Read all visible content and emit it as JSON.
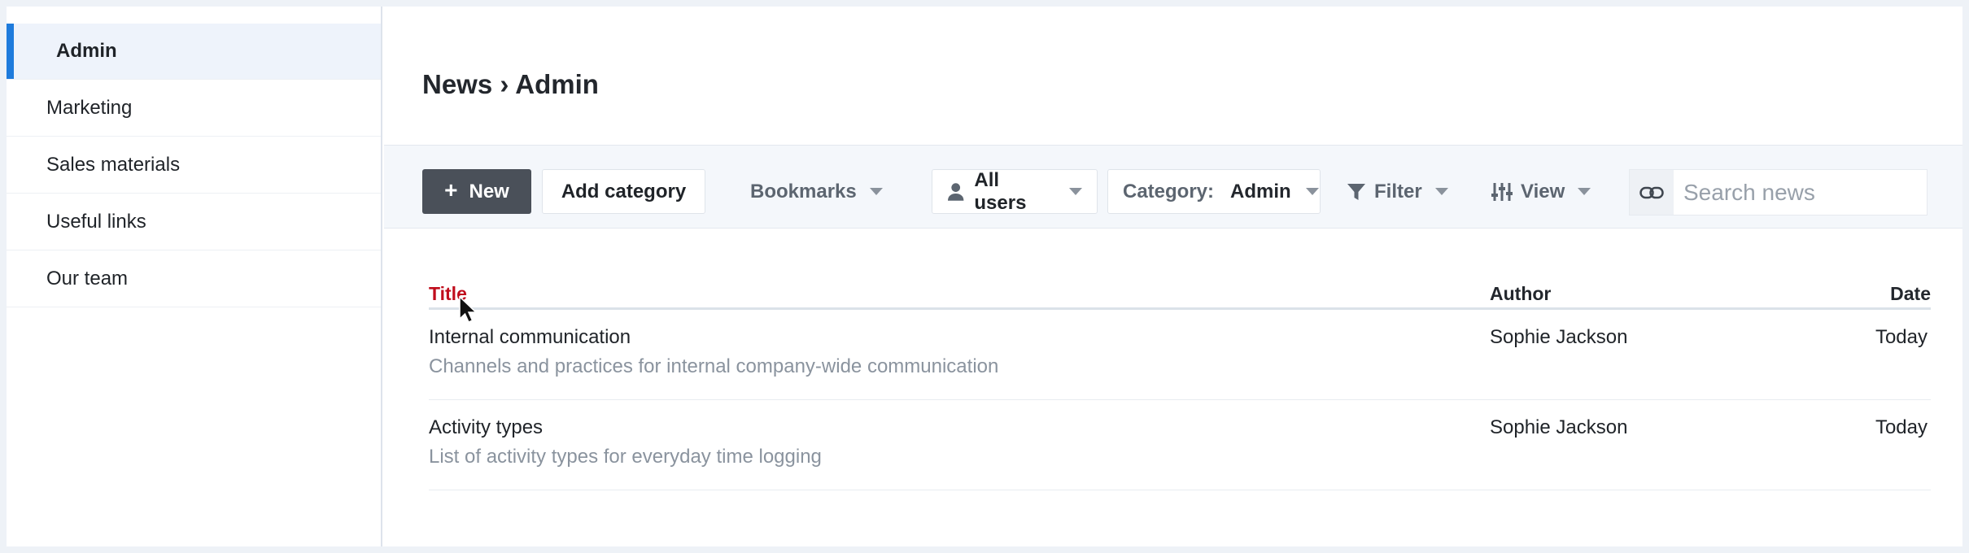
{
  "sidebar": {
    "items": [
      {
        "label": "Admin",
        "active": true
      },
      {
        "label": "Marketing"
      },
      {
        "label": "Sales materials"
      },
      {
        "label": "Useful links"
      },
      {
        "label": "Our team"
      }
    ]
  },
  "page": {
    "title": "News › Admin"
  },
  "toolbar": {
    "new_label": "New",
    "new_icon": "+",
    "add_category_label": "Add category",
    "bookmarks_label": "Bookmarks",
    "users_label": "All users",
    "category_prefix": "Category:",
    "category_value": "Admin",
    "filter_label": "Filter",
    "view_label": "View"
  },
  "search": {
    "placeholder": "Search news"
  },
  "table": {
    "columns": {
      "title": "Title",
      "author": "Author",
      "date": "Date"
    },
    "rows": [
      {
        "title": "Internal communication",
        "description": "Channels and practices for internal company-wide communication",
        "author": "Sophie Jackson",
        "date": "Today"
      },
      {
        "title": "Activity types",
        "description": "List of activity types for everyday time logging",
        "author": "Sophie Jackson",
        "date": "Today"
      }
    ]
  },
  "colors": {
    "accent": "#1e7bdc",
    "sort_active": "#c00d1c",
    "primary_button": "#4a5059"
  }
}
